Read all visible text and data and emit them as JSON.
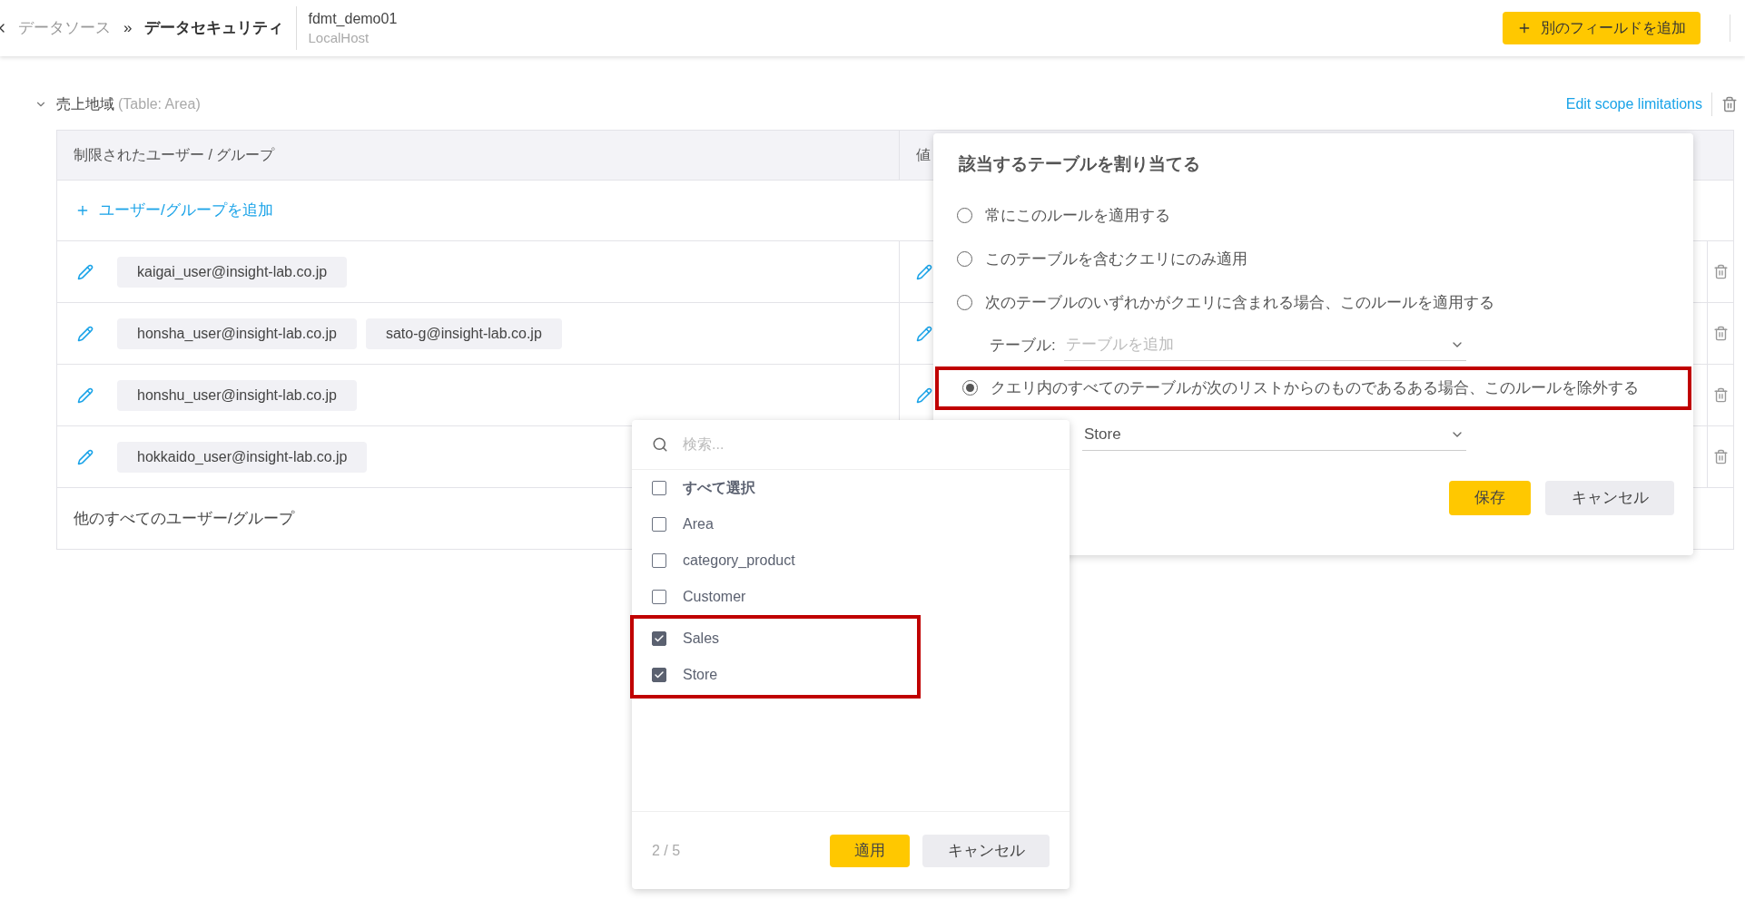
{
  "breadcrumb": {
    "items": [
      {
        "label": "データソース",
        "current": false
      },
      {
        "label": "データセキュリティ",
        "current": true
      }
    ],
    "separator": "»"
  },
  "datasource": {
    "name": "fdmt_demo01",
    "host": "LocalHost"
  },
  "add_field_button": {
    "label": "別のフィールドを追加"
  },
  "section": {
    "title": "売上地域",
    "subtitle": "(Table: Area)",
    "expanded": true,
    "edit_link": "Edit scope limitations"
  },
  "table": {
    "columns": [
      "制限されたユーザー / グループ",
      "値"
    ],
    "add_row_label": "ユーザー/グループを追加",
    "rows": [
      {
        "users": [
          "kaigai_user@insight-lab.co.jp"
        ]
      },
      {
        "users": [
          "honsha_user@insight-lab.co.jp",
          "sato-g@insight-lab.co.jp"
        ]
      },
      {
        "users": [
          "honshu_user@insight-lab.co.jp"
        ]
      },
      {
        "users": [
          "hokkaido_user@insight-lab.co.jp"
        ]
      }
    ],
    "other_row": "他のすべてのユーザー/グループ"
  },
  "scope_dialog": {
    "title": "該当するテーブルを割り当てる",
    "options": [
      {
        "label": "常にこのルールを適用する",
        "selected": false,
        "highlighted": false
      },
      {
        "label": "このテーブルを含むクエリにのみ適用",
        "selected": false,
        "highlighted": false
      },
      {
        "label": "次のテーブルのいずれかがクエリに含まれる場合、このルールを適用する",
        "selected": false,
        "highlighted": false
      },
      {
        "label": "クエリ内のすべてのテーブルが次のリストからのものであるある場合、このルールを除外する",
        "selected": true,
        "highlighted": true
      }
    ],
    "table_field": {
      "label": "テーブル:",
      "placeholder": "テーブルを追加"
    },
    "exclude_field": {
      "value": "Store"
    },
    "save": "保存",
    "cancel": "キャンセル"
  },
  "table_picker": {
    "search_placeholder": "検索...",
    "select_all": {
      "label": "すべて選択",
      "checked": false
    },
    "items": [
      {
        "label": "Area",
        "checked": false,
        "highlighted": false
      },
      {
        "label": "category_product",
        "checked": false,
        "highlighted": false
      },
      {
        "label": "Customer",
        "checked": false,
        "highlighted": false
      },
      {
        "label": "Sales",
        "checked": true,
        "highlighted": true
      },
      {
        "label": "Store",
        "checked": true,
        "highlighted": true
      }
    ],
    "count": "2 / 5",
    "apply": "適用",
    "cancel": "キャンセル"
  }
}
